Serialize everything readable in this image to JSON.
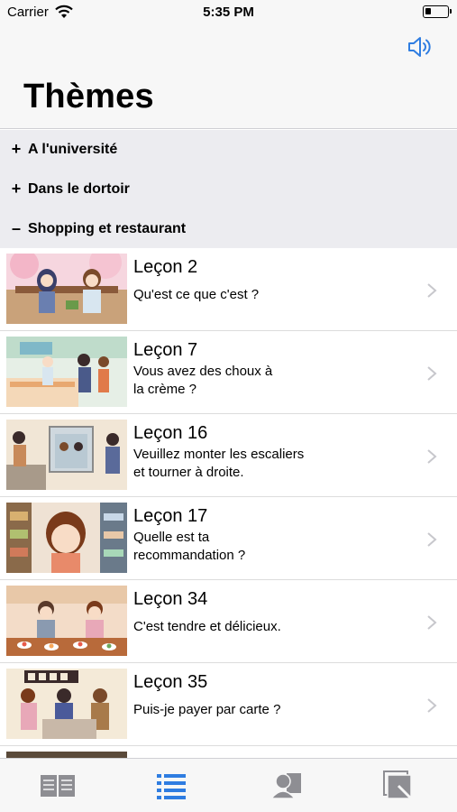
{
  "status_bar": {
    "carrier": "Carrier",
    "time": "5:35 PM"
  },
  "nav": {
    "title": "Thèmes"
  },
  "sections": [
    {
      "sign": "+",
      "label": "A l'université",
      "expanded": false
    },
    {
      "sign": "+",
      "label": "Dans le dortoir",
      "expanded": false
    },
    {
      "sign": "–",
      "label": "Shopping et restaurant",
      "expanded": true
    }
  ],
  "lessons": [
    {
      "title": "Leçon 2",
      "subtitle_line1": "Qu'est ce que c'est ?",
      "subtitle_line2": ""
    },
    {
      "title": "Leçon 7",
      "subtitle_line1": "Vous avez des choux à",
      "subtitle_line2": "la crème ?"
    },
    {
      "title": "Leçon 16",
      "subtitle_line1": "Veuillez monter les escaliers",
      "subtitle_line2": "et tourner à droite."
    },
    {
      "title": "Leçon 17",
      "subtitle_line1": "Quelle est ta",
      "subtitle_line2": "recommandation ?"
    },
    {
      "title": "Leçon 34",
      "subtitle_line1": "C'est tendre et délicieux.",
      "subtitle_line2": ""
    },
    {
      "title": "Leçon 35",
      "subtitle_line1": "Puis-je payer par carte ?",
      "subtitle_line2": ""
    }
  ],
  "tabs": [
    {
      "icon": "book-icon",
      "active": false
    },
    {
      "icon": "list-icon",
      "active": true
    },
    {
      "icon": "profile-icon",
      "active": false
    },
    {
      "icon": "cards-icon",
      "active": false
    }
  ],
  "colors": {
    "accent": "#2f7de1",
    "tab_inactive": "#8e8e93",
    "section_bg": "#ececf0"
  }
}
